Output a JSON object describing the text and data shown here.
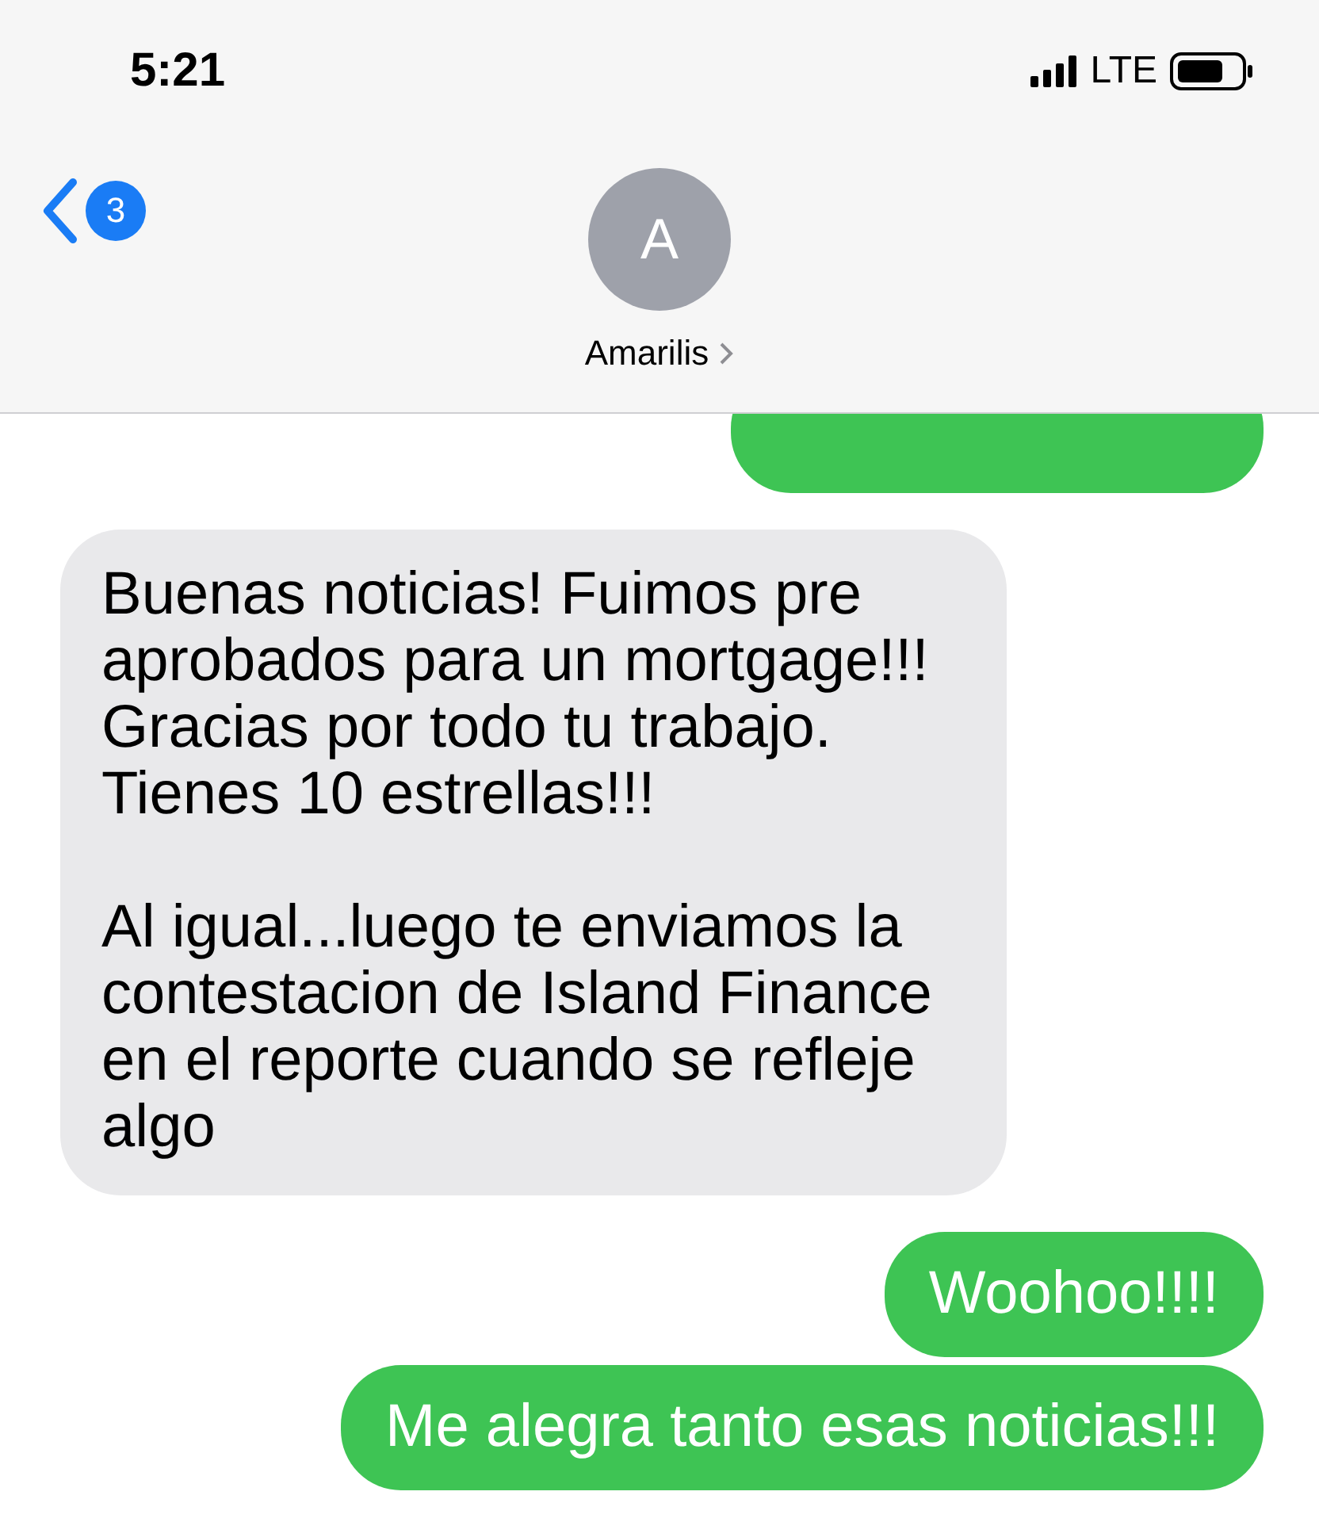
{
  "status_bar": {
    "time": "5:21",
    "network": "LTE"
  },
  "header": {
    "unread_count": "3",
    "avatar_initial": "A",
    "contact_name": "Amarilis"
  },
  "messages": [
    {
      "kind": "sent"
    },
    {
      "kind": "received",
      "paragraphs": [
        "Buenas noticias! Fuimos pre aprobados para un mortgage!!! Gracias por todo tu trabajo. Tienes 10 estrellas!!!",
        "Al igual...luego te enviamos la contestacion de Island Finance en el reporte cuando se refleje algo"
      ]
    },
    {
      "kind": "sent",
      "paragraphs": [
        "Woohoo!!!!"
      ]
    },
    {
      "kind": "sent",
      "paragraphs": [
        "Me alegra tanto esas noticias!!!"
      ]
    }
  ]
}
